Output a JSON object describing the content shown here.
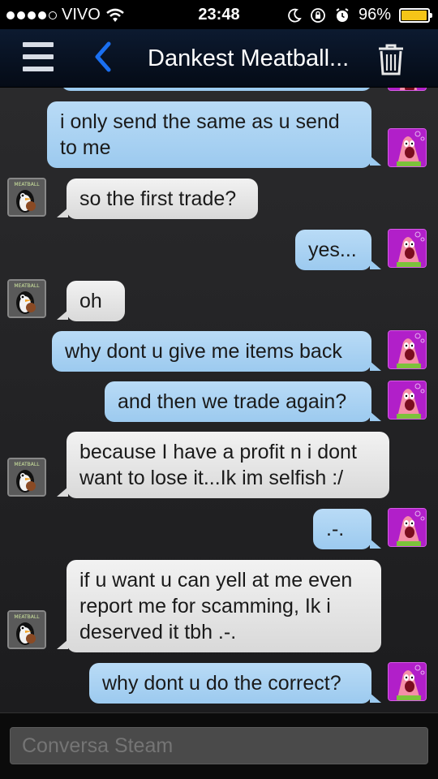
{
  "status_bar": {
    "carrier": "VIVO",
    "time": "23:48",
    "battery": "96%",
    "battery_level": 0.96,
    "signal_icon": "signal-dots-icon",
    "wifi_icon": "wifi-icon"
  },
  "navbar": {
    "title": "Dankest Meatball...",
    "menu_icon": "hamburger-menu-icon",
    "back_icon": "chevron-left-icon",
    "delete_icon": "trash-icon",
    "accent_color": "#1a6ff0"
  },
  "messages": [
    {
      "from": "me",
      "text_lines": [
        "i only send the same as u send",
        "to me"
      ]
    },
    {
      "from": "them",
      "text_lines": [
        "so the first trade?"
      ]
    },
    {
      "from": "me",
      "text_lines": [
        "yes..."
      ]
    },
    {
      "from": "them",
      "text_lines": [
        "oh"
      ]
    },
    {
      "from": "me",
      "text_lines": [
        "why dont u give me items back"
      ]
    },
    {
      "from": "me",
      "text_lines": [
        "and then we trade again?"
      ]
    },
    {
      "from": "them",
      "text_lines": [
        "because I have a profit n i dont",
        "want to lose it...Ik im selfish :/"
      ]
    },
    {
      "from": "me",
      "text_lines": [
        ".-."
      ]
    },
    {
      "from": "them",
      "text_lines": [
        "if u want u can yell at me even",
        "report me for scamming, Ik i",
        "deserved it tbh .-."
      ]
    },
    {
      "from": "me",
      "text_lines": [
        "why dont u do the correct?"
      ]
    }
  ],
  "avatars": {
    "them_label": "MEATBALL",
    "them_icon": "penguin-avatar-icon",
    "me_icon": "patrick-avatar-icon"
  },
  "input": {
    "placeholder": "Conversa Steam"
  }
}
